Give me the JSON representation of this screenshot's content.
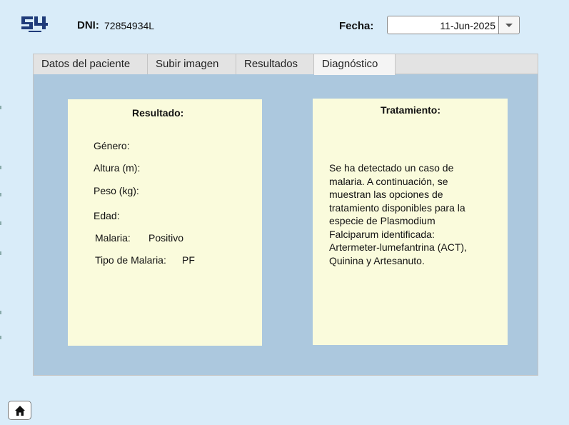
{
  "header": {
    "logo_icon": "s4-logo-icon",
    "dni_label": "DNI:",
    "dni_value": "72854934L",
    "fecha_label": "Fecha:",
    "fecha_value": "11-Jun-2025"
  },
  "tabs": [
    {
      "label": "Datos del paciente",
      "active": false
    },
    {
      "label": "Subir imagen",
      "active": false
    },
    {
      "label": "Resultados",
      "active": false
    },
    {
      "label": "Diagnóstico",
      "active": true
    }
  ],
  "resultado": {
    "title": "Resultado:",
    "genero_label": "Género:",
    "altura_label": "Altura (m):",
    "peso_label": "Peso (kg):",
    "edad_label": "Edad:",
    "malaria_label": "Malaria:",
    "malaria_value": "Positivo",
    "tipo_label": "Tipo de Malaria:",
    "tipo_value": "PF"
  },
  "tratamiento": {
    "title": "Tratamiento:",
    "text": "Se ha detectado un caso de malaria. A continuación, se muestran las opciones de tratamiento disponibles para la especie de Plasmodium Falciparum identificada: Artermeter-lumefantrina (ACT), Quinina y Artesanuto."
  },
  "footer": {
    "home_icon": "home-icon"
  },
  "colors": {
    "background": "#d9ecf9",
    "panel": "#acc8de",
    "card": "#fafbdc",
    "logo": "#1f3b7a"
  }
}
